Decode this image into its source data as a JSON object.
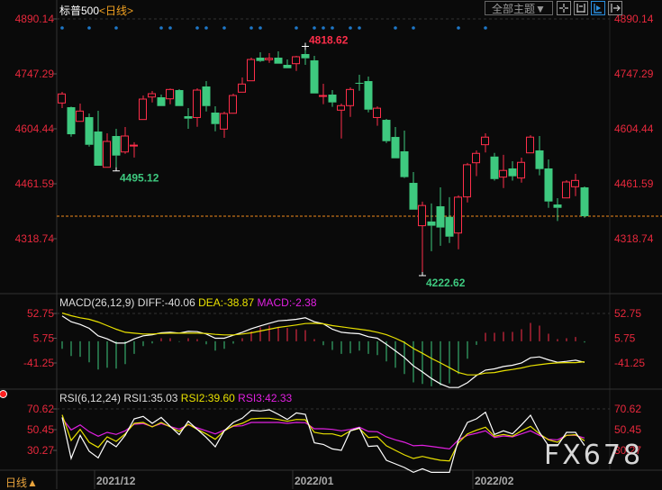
{
  "header": {
    "instrument": "标普500",
    "period": "<日线>"
  },
  "toolbar": {
    "theme_label": "全部主题▼",
    "icons": [
      "crosshair-icon",
      "range-icon",
      "play-cursor-icon",
      "move-right-icon"
    ],
    "active_icon": "play-cursor-icon"
  },
  "footer": {
    "period_label": "日线▲"
  },
  "watermark": "FX678",
  "colors": {
    "up": "#ff2e4a",
    "down": "#3ec97f",
    "axis_text": "#e8283c",
    "diff": "#ffffff",
    "dea": "#e8e000",
    "macd": "#e020e0",
    "rsi1": "#ffffff",
    "rsi2": "#e8e000",
    "rsi3": "#e020e0",
    "current_price_line": "#f08a1c",
    "marker": "#1e78c8"
  },
  "chart_data": [
    {
      "type": "candlestick",
      "price_axis_labels": [
        "4890.14",
        "4747.29",
        "4604.44",
        "4461.59",
        "4318.74"
      ],
      "ylim": [
        4318.74,
        4890.14
      ],
      "current_price": 4377.2,
      "annotations": [
        {
          "text": "4818.62",
          "index": 27,
          "kind": "high"
        },
        {
          "text": "4495.12",
          "index": 6,
          "kind": "low"
        },
        {
          "text": "4222.62",
          "index": 40,
          "kind": "low"
        }
      ],
      "event_markers": [
        0,
        3,
        6,
        11,
        12,
        15,
        16,
        18,
        21,
        22,
        26,
        28,
        29,
        30,
        32,
        33,
        37,
        39,
        44,
        47
      ],
      "ohlc": [
        [
          4671.6,
          4700.4,
          4658.3,
          4695.0
        ],
        [
          4660.6,
          4662.2,
          4584.0,
          4590.3
        ],
        [
          4623.8,
          4670.0,
          4623.8,
          4650.5
        ],
        [
          4634.8,
          4644.2,
          4558.2,
          4562.9
        ],
        [
          4597.4,
          4651.2,
          4508.4,
          4508.4
        ],
        [
          4504.4,
          4592.7,
          4504.4,
          4571.6
        ],
        [
          4585.7,
          4604.4,
          4495.1,
          4534.9
        ],
        [
          4544.2,
          4609.1,
          4539.5,
          4585.7
        ],
        [
          4561.0,
          4569.7,
          4529.8,
          4562.0
        ],
        [
          4628.6,
          4691.0,
          4628.6,
          4681.7
        ],
        [
          4687.1,
          4702.8,
          4673.0,
          4695.7
        ],
        [
          4686.4,
          4693.4,
          4663.6,
          4663.6
        ],
        [
          4682.4,
          4709.1,
          4668.3,
          4706.7
        ],
        [
          4705.1,
          4707.4,
          4663.6,
          4663.6
        ],
        [
          4637.2,
          4658.3,
          4604.4,
          4630.9
        ],
        [
          4633.8,
          4709.8,
          4609.8,
          4705.1
        ],
        [
          4714.5,
          4728.5,
          4649.6,
          4663.6
        ],
        [
          4646.6,
          4662.9,
          4598.0,
          4616.8
        ],
        [
          4603.7,
          4648.8,
          4581.0,
          4644.1
        ],
        [
          4644.9,
          4695.7,
          4644.1,
          4691.0
        ],
        [
          4699.7,
          4737.9,
          4699.7,
          4720.8
        ],
        [
          4729.3,
          4789.4,
          4729.3,
          4784.6
        ],
        [
          4789.4,
          4803.5,
          4778.4,
          4780.8
        ],
        [
          4784.1,
          4801.2,
          4776.1,
          4787.8
        ],
        [
          4789.4,
          4805.9,
          4773.8,
          4773.8
        ],
        [
          4770.7,
          4784.8,
          4762.0,
          4762.0
        ],
        [
          4773.8,
          4794.1,
          4755.0,
          4791.8
        ],
        [
          4798.8,
          4818.6,
          4770.7,
          4787.8
        ],
        [
          4782.4,
          4794.1,
          4696.4,
          4696.4
        ],
        [
          4690.0,
          4721.5,
          4668.6,
          4691.0
        ],
        [
          4693.4,
          4705.1,
          4661.4,
          4673.1
        ],
        [
          4652.9,
          4670.0,
          4579.3,
          4664.6
        ],
        [
          4664.6,
          4712.1,
          4635.6,
          4706.7
        ],
        [
          4724.0,
          4744.9,
          4703.5,
          4723.0
        ],
        [
          4728.5,
          4740.2,
          4647.3,
          4654.3
        ],
        [
          4633.8,
          4662.7,
          4612.2,
          4658.0
        ],
        [
          4627.8,
          4630.2,
          4567.6,
          4572.3
        ],
        [
          4583.3,
          4609.1,
          4527.8,
          4527.8
        ],
        [
          4545.9,
          4599.8,
          4476.5,
          4478.9
        ],
        [
          4463.9,
          4492.0,
          4394.3,
          4394.3
        ],
        [
          4352.5,
          4415.1,
          4222.6,
          4405.0
        ],
        [
          4363.5,
          4410.3,
          4286.2,
          4352.5
        ],
        [
          4403.0,
          4452.2,
          4300.2,
          4347.8
        ],
        [
          4375.6,
          4426.7,
          4307.7,
          4324.1
        ],
        [
          4333.5,
          4431.4,
          4291.1,
          4426.7
        ],
        [
          4427.4,
          4515.7,
          4413.1,
          4511.0
        ],
        [
          4516.2,
          4548.3,
          4481.6,
          4540.6
        ],
        [
          4563.1,
          4592.7,
          4542.9,
          4582.8
        ],
        [
          4532.3,
          4541.7,
          4469.9,
          4473.8
        ],
        [
          4478.9,
          4536.7,
          4450.6,
          4496.2
        ],
        [
          4501.4,
          4520.1,
          4469.9,
          4481.1
        ],
        [
          4476.5,
          4529.6,
          4464.6,
          4517.2
        ],
        [
          4541.9,
          4587.9,
          4541.9,
          4582.8
        ],
        [
          4548.3,
          4585.7,
          4483.5,
          4499.8
        ],
        [
          4501.4,
          4524.8,
          4399.0,
          4415.5
        ],
        [
          4407.7,
          4424.1,
          4364.7,
          4399.0
        ],
        [
          4424.8,
          4470.9,
          4424.8,
          4466.2
        ],
        [
          4453.8,
          4487.3,
          4429.5,
          4470.2
        ],
        [
          4452.2,
          4454.5,
          4373.3,
          4377.2
        ]
      ],
      "x_axis": [
        {
          "label": "2021/12",
          "index": 4
        },
        {
          "label": "2022/01",
          "index": 26
        },
        {
          "label": "2022/02",
          "index": 46
        }
      ]
    },
    {
      "type": "macd",
      "title": "MACD(26,12,9)",
      "legend": {
        "diff": "DIFF:-40.06",
        "dea": "DEA:-38.87",
        "macd": "MACD:-2.38"
      },
      "axis_labels": [
        "52.75",
        "5.75",
        "-41.25"
      ],
      "ylim": [
        -41.25,
        52.75
      ],
      "diff": [
        47.9,
        37.0,
        31.9,
        24.5,
        10.3,
        4.6,
        -3.4,
        -3.4,
        4.6,
        10.3,
        12.5,
        16.0,
        17.1,
        15.4,
        18.8,
        18.2,
        13.7,
        5.7,
        5.7,
        11.4,
        17.1,
        23.9,
        29.1,
        34.2,
        38.8,
        39.9,
        41.6,
        44.5,
        37.1,
        33.1,
        22.8,
        17.1,
        15.4,
        14.3,
        8.6,
        5.7,
        -5.7,
        -18.2,
        -30.8,
        -46.7,
        -58.1,
        -70.7,
        -80.9,
        -87.8,
        -87.8,
        -78.7,
        -65.0,
        -54.7,
        -52.4,
        -47.9,
        -45.6,
        -41.0,
        -31.4,
        -29.6,
        -35.3,
        -39.9,
        -38.2,
        -35.9,
        -40.06
      ],
      "dea": [
        53.6,
        48.5,
        44.5,
        41.6,
        36.5,
        29.6,
        22.8,
        17.1,
        15.4,
        13.7,
        13.7,
        14.8,
        15.4,
        15.4,
        15.4,
        15.4,
        14.8,
        13.1,
        12.0,
        12.0,
        13.7,
        16.0,
        19.4,
        22.8,
        26.2,
        28.5,
        30.8,
        33.6,
        34.2,
        33.1,
        29.6,
        27.4,
        25.1,
        22.8,
        20.5,
        17.1,
        12.5,
        5.7,
        -2.3,
        -13.7,
        -22.8,
        -32.5,
        -41.0,
        -50.2,
        -59.3,
        -63.8,
        -63.8,
        -60.4,
        -59.3,
        -55.9,
        -53.6,
        -50.7,
        -46.7,
        -44.5,
        -42.2,
        -41.0,
        -40.5,
        -40.5,
        -38.87
      ],
      "macd": [
        -14.3,
        -27.9,
        -29.6,
        -39.9,
        -53.6,
        -50.2,
        -51.9,
        -43.3,
        -23.9,
        -9.1,
        -4.0,
        5.7,
        5.7,
        -1.0,
        5.7,
        4.0,
        -5.7,
        -17.7,
        -14.3,
        -4.6,
        5.7,
        18.8,
        26.2,
        29.6,
        27.4,
        25.1,
        22.8,
        21.1,
        4.0,
        -7.4,
        -16.5,
        -23.9,
        -22.8,
        -17.7,
        -23.9,
        -26.2,
        -38.2,
        -50.2,
        -62.1,
        -78.1,
        -80.9,
        -85.5,
        -83.8,
        -79.8,
        -62.1,
        -33.1,
        -6.8,
        16.0,
        16.0,
        17.7,
        17.7,
        22.8,
        34.8,
        29.6,
        14.3,
        4.0,
        5.7,
        8.0,
        -2.38
      ]
    },
    {
      "type": "rsi",
      "title": "RSI(6,12,24)",
      "legend": {
        "rsi1": "RSI1:35.03",
        "rsi2": "RSI2:39.60",
        "rsi3": "RSI3:42.33"
      },
      "axis_labels": [
        "70.62",
        "50.45",
        "30.27"
      ],
      "ylim": [
        30.27,
        70.62
      ],
      "rsi1": [
        62.4,
        22.4,
        44.9,
        29.4,
        23.0,
        39.6,
        33.8,
        44.9,
        61.0,
        63.3,
        56.6,
        62.4,
        53.7,
        45.5,
        58.6,
        50.7,
        42.8,
        33.8,
        49.3,
        57.5,
        61.6,
        69.2,
        68.6,
        69.7,
        65.4,
        60.4,
        66.8,
        65.4,
        37.6,
        36.1,
        31.7,
        30.3,
        49.3,
        52.2,
        34.1,
        34.7,
        20.6,
        17.1,
        13.6,
        8.9,
        12.4,
        8.9,
        8.9,
        8.9,
        40.5,
        57.5,
        61.0,
        67.4,
        45.8,
        49.3,
        46.3,
        55.1,
        64.5,
        47.8,
        34.7,
        34.7,
        47.8,
        47.8,
        35.03
      ],
      "rsi2": [
        64.8,
        39.9,
        50.7,
        38.2,
        33.2,
        43.4,
        39.0,
        46.3,
        56.6,
        57.5,
        53.1,
        57.5,
        53.1,
        48.7,
        55.7,
        50.7,
        46.3,
        41.1,
        49.3,
        54.2,
        56.6,
        61.0,
        61.6,
        61.6,
        60.4,
        58.6,
        60.4,
        60.1,
        47.8,
        46.3,
        46.3,
        44.0,
        49.3,
        51.6,
        42.8,
        43.4,
        34.7,
        30.3,
        25.9,
        22.4,
        24.4,
        22.4,
        20.6,
        20.0,
        37.6,
        46.3,
        49.9,
        52.8,
        44.0,
        45.8,
        44.0,
        49.3,
        53.7,
        46.3,
        40.5,
        38.2,
        44.9,
        45.5,
        39.6
      ],
      "rsi3": [
        61.5,
        50.2,
        55.1,
        48.4,
        44.0,
        47.8,
        45.8,
        49.3,
        55.7,
        56.3,
        53.4,
        56.3,
        53.4,
        51.0,
        55.1,
        52.2,
        49.3,
        46.3,
        49.9,
        53.7,
        54.2,
        57.5,
        57.5,
        57.5,
        57.5,
        56.6,
        57.5,
        57.2,
        51.3,
        51.3,
        50.7,
        49.3,
        50.7,
        52.8,
        48.7,
        48.4,
        43.4,
        40.5,
        38.2,
        34.7,
        35.2,
        34.1,
        32.9,
        31.7,
        40.5,
        44.9,
        46.9,
        49.3,
        42.8,
        44.3,
        43.4,
        46.3,
        49.3,
        44.9,
        41.1,
        40.5,
        44.9,
        44.9,
        42.33
      ]
    }
  ]
}
